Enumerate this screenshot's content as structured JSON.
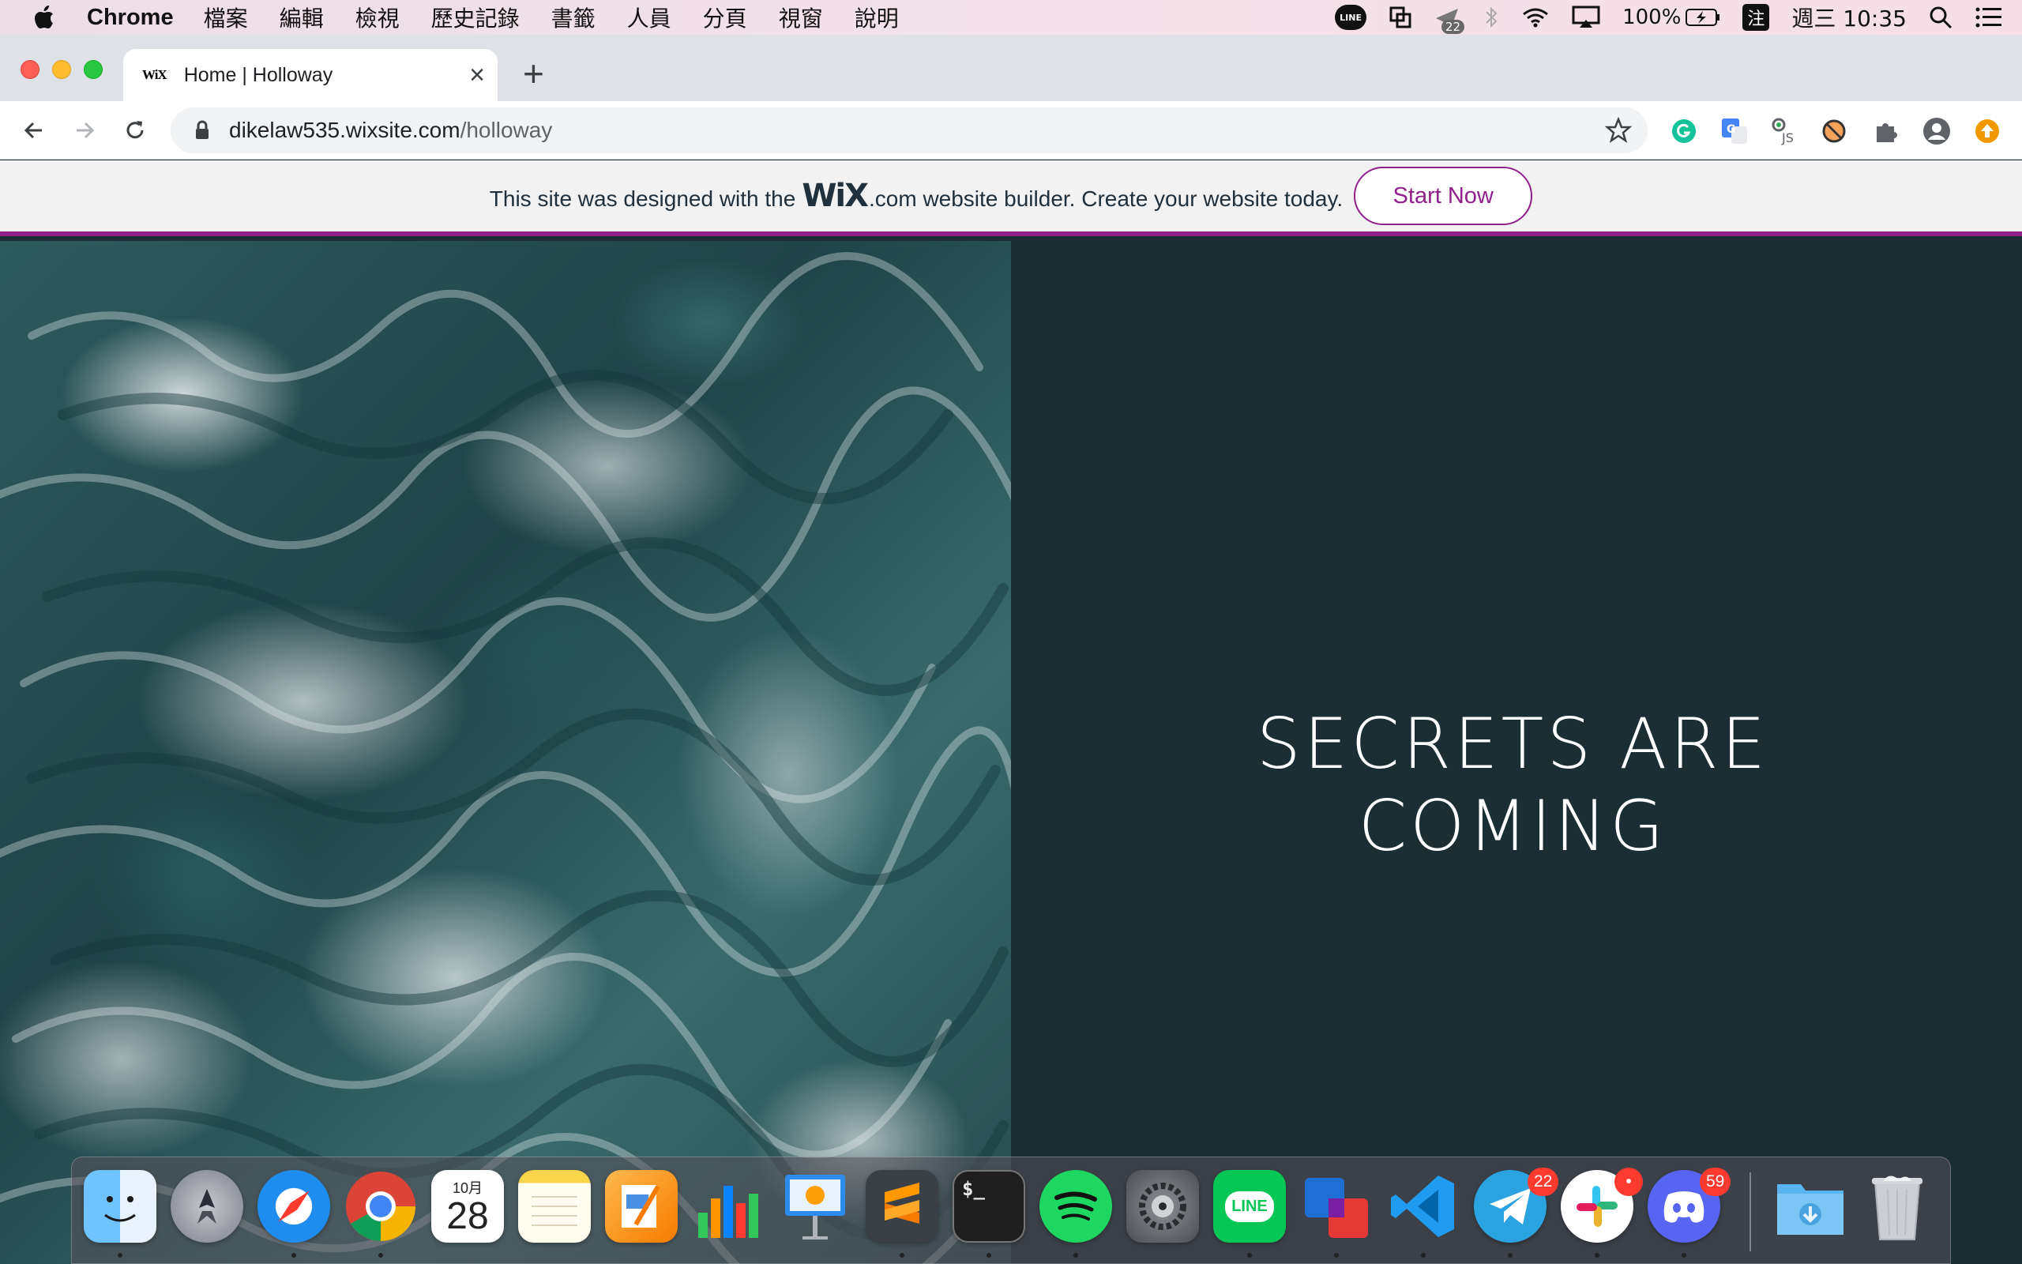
{
  "menubar": {
    "app_name": "Chrome",
    "menus": [
      "檔案",
      "編輯",
      "檢視",
      "歷史記錄",
      "書籤",
      "人員",
      "分頁",
      "視窗",
      "說明"
    ],
    "line_label": "LINE",
    "notif_count": "22",
    "battery": "100%",
    "ime_label": "注",
    "clock": "週三 10:35"
  },
  "browser": {
    "tab_favicon": "WiX",
    "tab_title": "Home | Holloway",
    "url_host": "dikelaw535.wixsite.com",
    "url_path": "/holloway"
  },
  "wix_banner": {
    "text_before": "This site was designed with the",
    "brand": "WiX",
    "text_after": ".com website builder. Create your website today.",
    "button_label": "Start Now"
  },
  "page": {
    "headline_line1": "SECRETS ARE",
    "headline_line2": "COMING"
  },
  "dock": {
    "calendar_month": "10月",
    "calendar_day": "28",
    "terminal_prompt": "$_",
    "line_label": "LINE",
    "telegram_badge": "22",
    "slack_badge": "•",
    "discord_badge": "59"
  },
  "colors": {
    "wix_accent": "#90218b",
    "hero_panel": "#1a2e33"
  }
}
